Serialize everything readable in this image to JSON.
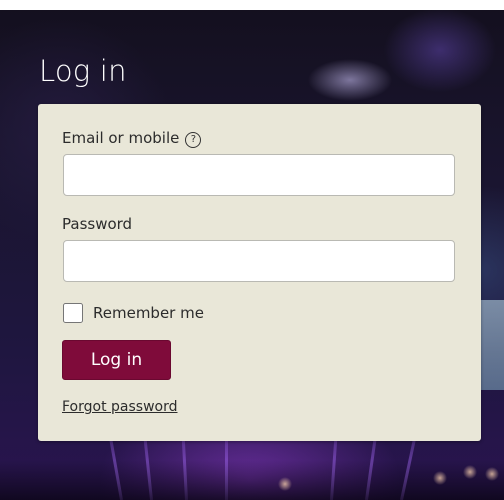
{
  "page": {
    "title": "Log in"
  },
  "form": {
    "email_label": "Email or mobile",
    "email_help_icon": "question-circle-icon",
    "email_value": "",
    "password_label": "Password",
    "password_value": "",
    "remember_label": "Remember me",
    "remember_checked": false,
    "submit_label": "Log in",
    "forgot_label": "Forgot password"
  },
  "colors": {
    "panel_background": "#e9e7d8",
    "button_background": "#7f0b3a",
    "title_text": "#ffffff"
  }
}
